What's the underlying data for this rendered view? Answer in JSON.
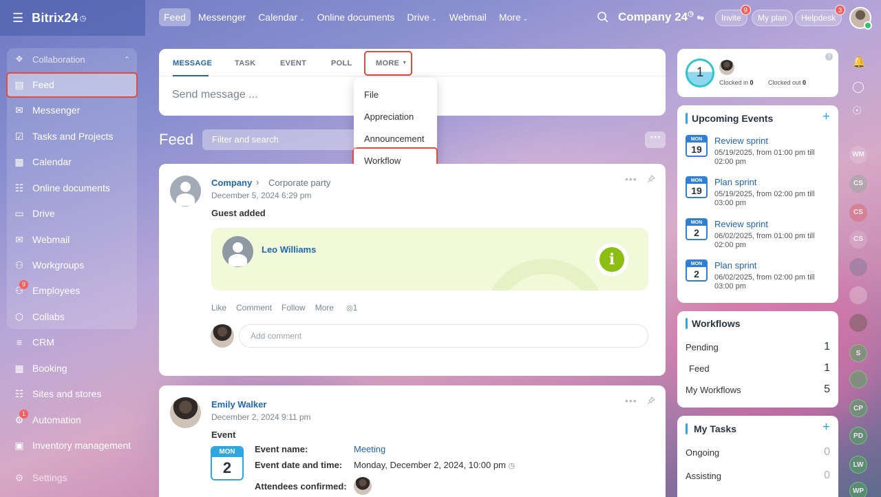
{
  "header": {
    "logo": "Bitrix24",
    "nav": [
      {
        "label": "Feed",
        "active": true,
        "caret": false
      },
      {
        "label": "Messenger",
        "active": false,
        "caret": false
      },
      {
        "label": "Calendar",
        "active": false,
        "caret": true
      },
      {
        "label": "Online documents",
        "active": false,
        "caret": false
      },
      {
        "label": "Drive",
        "active": false,
        "caret": true
      },
      {
        "label": "Webmail",
        "active": false,
        "caret": false
      },
      {
        "label": "More",
        "active": false,
        "caret": true
      }
    ],
    "company": "Company 24",
    "invite": "Invite",
    "invite_badge": "9",
    "my_plan": "My plan",
    "helpdesk": "Helpdesk",
    "helpdesk_badge": "3"
  },
  "sidebar": {
    "group_label": "Collaboration",
    "items": [
      {
        "label": "Feed",
        "icon": "feed-icon"
      },
      {
        "label": "Messenger",
        "icon": "messenger-icon"
      },
      {
        "label": "Tasks and Projects",
        "icon": "tasks-icon"
      },
      {
        "label": "Calendar",
        "icon": "calendar-icon"
      },
      {
        "label": "Online documents",
        "icon": "document-icon"
      },
      {
        "label": "Drive",
        "icon": "drive-icon"
      },
      {
        "label": "Webmail",
        "icon": "mail-icon"
      },
      {
        "label": "Workgroups",
        "icon": "workgroups-icon"
      },
      {
        "label": "Employees",
        "icon": "employees-icon",
        "badge": "9"
      },
      {
        "label": "Collabs",
        "icon": "collabs-icon"
      },
      {
        "label": "CRM",
        "icon": "crm-icon"
      },
      {
        "label": "Booking",
        "icon": "booking-icon"
      },
      {
        "label": "Sites and stores",
        "icon": "cart-icon"
      },
      {
        "label": "Automation",
        "icon": "automation-icon",
        "badge": "1"
      },
      {
        "label": "Inventory management",
        "icon": "inventory-icon"
      },
      {
        "label": "Settings",
        "icon": "gear-icon"
      }
    ]
  },
  "composer": {
    "tabs": [
      "MESSAGE",
      "TASK",
      "EVENT",
      "POLL",
      "MORE"
    ],
    "placeholder": "Send message ..."
  },
  "more_menu": [
    "File",
    "Appreciation",
    "Announcement",
    "Workflow"
  ],
  "feed": {
    "title": "Feed",
    "filter_placeholder": "Filter and search"
  },
  "post1": {
    "author": "Company",
    "destination": "Corporate party",
    "date": "December 5, 2024 6:29 pm",
    "text": "Guest added",
    "guest": "Leo Williams",
    "actions": [
      "Like",
      "Comment",
      "Follow",
      "More"
    ],
    "views": "1",
    "comment_placeholder": "Add comment"
  },
  "post2": {
    "author": "Emily Walker",
    "date": "December 2, 2024 9:11 pm",
    "type": "Event",
    "cal_month": "MON",
    "cal_day": "2",
    "event_name_label": "Event name:",
    "event_name": "Meeting",
    "event_date_label": "Event date and time:",
    "event_date": "Monday, December 2, 2024, 10:00 pm",
    "attendees_label": "Attendees confirmed:"
  },
  "timeman": {
    "hours": "1",
    "clocked_in_label": "Clocked in",
    "clocked_in": "0",
    "clocked_out_label": "Clocked out",
    "clocked_out": "0"
  },
  "upcoming": {
    "title": "Upcoming Events",
    "events": [
      {
        "month": "MON",
        "day": "19",
        "title": "Review sprint",
        "time": "05/19/2025, from 01:00 pm till 02:00 pm"
      },
      {
        "month": "MON",
        "day": "19",
        "title": "Plan sprint",
        "time": "05/19/2025, from 02:00 pm till 03:00 pm"
      },
      {
        "month": "MON",
        "day": "2",
        "title": "Review sprint",
        "time": "06/02/2025, from 01:00 pm till 02:00 pm"
      },
      {
        "month": "MON",
        "day": "2",
        "title": "Plan sprint",
        "time": "06/02/2025, from 02:00 pm till 03:00 pm"
      }
    ]
  },
  "workflows": {
    "title": "Workflows",
    "rows": [
      {
        "label": "Pending",
        "value": "1"
      },
      {
        "label": "Feed",
        "value": "1"
      },
      {
        "label": "My Workflows",
        "value": "5"
      }
    ]
  },
  "tasks": {
    "title": "My Tasks",
    "rows": [
      {
        "label": "Ongoing",
        "value": "0"
      },
      {
        "label": "Assisting",
        "value": "0"
      }
    ]
  },
  "rail": [
    "WM",
    "CS",
    "CS",
    "CS",
    "S",
    "CP",
    "PD",
    "LW",
    "WP"
  ],
  "colors": {
    "accent": "#2066b0",
    "highlight": "#e24a3b",
    "badge": "#f25f5c",
    "info_green": "#8cbd12"
  }
}
